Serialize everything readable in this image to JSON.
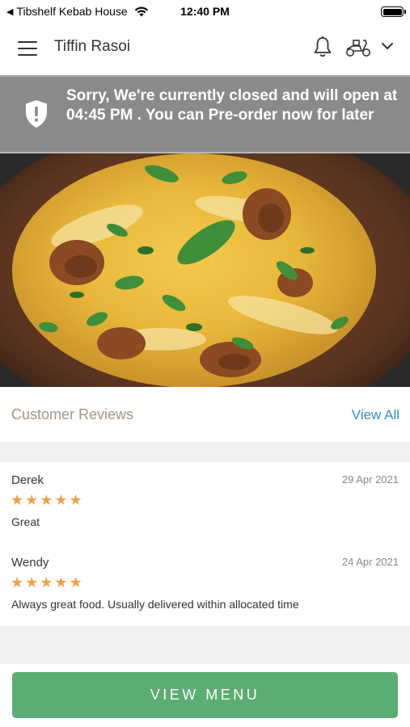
{
  "status_bar": {
    "back_glyph": "◀",
    "carrier": "Tibshelf Kebab House",
    "time": "12:40 PM"
  },
  "header": {
    "title": "Tiffin Rasoi"
  },
  "banner": {
    "message": "Sorry, We're currently closed and will open at 04:45 PM . You can Pre-order now for later",
    "color": "#8a8a8a"
  },
  "reviews": {
    "title": "Customer Reviews",
    "view_all_label": "View All",
    "items": [
      {
        "name": "Derek",
        "date": "29 Apr 2021",
        "rating": 5,
        "stars": "★★★★★",
        "text": "Great"
      },
      {
        "name": "Wendy",
        "date": "24 Apr 2021",
        "rating": 5,
        "stars": "★★★★★",
        "text": "Always great food. Usually delivered within allocated time"
      }
    ]
  },
  "footer": {
    "button_label": "VIEW MENU",
    "button_color": "#5cad73"
  },
  "colors": {
    "accent_link": "#2f8fc6",
    "star": "#f0a341",
    "section_title": "#a39683"
  }
}
